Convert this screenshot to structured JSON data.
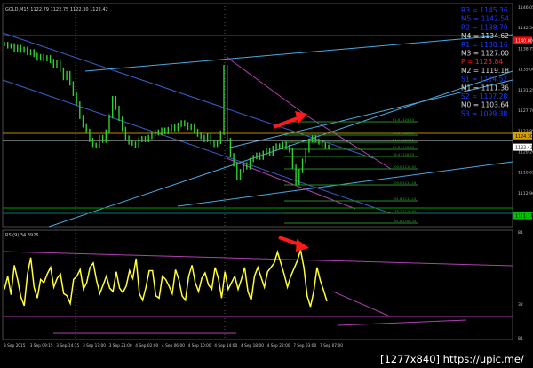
{
  "main_panel": {
    "title": "GOLD,M15  1122.79 1122.75 1122.30 1122.42",
    "y_ticks": [
      "1146.05",
      "1142.30",
      "1138.75",
      "1135.00",
      "1131.25",
      "1127.70",
      "1123.95",
      "1120.20",
      "1116.65",
      "1112.90",
      "1109.35"
    ],
    "price_labels": [
      {
        "text": "1140.00",
        "bg": "#ff0000",
        "fg": "#ffffff",
        "y_value": 1140.0
      },
      {
        "text": "1124.30",
        "bg": "#d4a000",
        "fg": "#000000",
        "y_value": 1124.3
      },
      {
        "text": "1122.42",
        "bg": "#ffffff",
        "fg": "#000000",
        "y_value": 1122.42
      },
      {
        "text": "1111.17",
        "bg": "#00c000",
        "fg": "#000000",
        "y_value": 1111.17
      }
    ],
    "pivots": [
      {
        "label": "R3",
        "value": "1145.36",
        "color": "#1a3cff",
        "bg": "#000000"
      },
      {
        "label": "M5",
        "value": "1142.54",
        "color": "#1a3cff",
        "bg": "#000000"
      },
      {
        "label": "R2",
        "value": "1138.70",
        "color": "#1a3cff",
        "bg": "#000000"
      },
      {
        "label": "M4",
        "value": "1134.62",
        "color": "#d8d8d8",
        "bg": "#000000"
      },
      {
        "label": "R1",
        "value": "1130.16",
        "color": "#1a3cff",
        "bg": "#000000"
      },
      {
        "label": "M3",
        "value": "1127.00",
        "color": "#d8d8d8",
        "bg": "#000000"
      },
      {
        "label": "P",
        "value": "1123.84",
        "color": "#ff2020",
        "bg": "#000000"
      },
      {
        "label": "M2",
        "value": "1119.18",
        "color": "#d8d8d8",
        "bg": "#000000"
      },
      {
        "label": "S1",
        "value": "1114.52",
        "color": "#1a3cff",
        "bg": "#000000"
      },
      {
        "label": "M1",
        "value": "1111.36",
        "color": "#d8d8d8",
        "bg": "#000000"
      },
      {
        "label": "S2",
        "value": "1107.28",
        "color": "#1a3cff",
        "bg": "#000000"
      },
      {
        "label": "M0",
        "value": "1103.64",
        "color": "#d8d8d8",
        "bg": "#000000"
      },
      {
        "label": "S3",
        "value": "1099.38",
        "color": "#1a3cff",
        "bg": "#000000"
      }
    ],
    "fib_labels": [
      "61.8 1124.43",
      "38.2 1122.11",
      "50.0 1120.95",
      "61.8 1119.80",
      "76.4 1118.33",
      "100.0 1116.02",
      "100.0 1114.16",
      "161.8 1112.10",
      "138.2 1110.65",
      "161.8 1108.33"
    ]
  },
  "rsi_panel": {
    "title": "RSI(9) 34.3926",
    "y_ticks": [
      "81",
      "32",
      "81"
    ]
  },
  "x_axis_labels": [
    "3 Sep 2015",
    "3 Sep 09:15",
    "3 Sep 14:15",
    "3 Sep 17:00",
    "3 Sep 21:00",
    "4 Sep 02:00",
    "4 Sep 06:00",
    "4 Sep 10:00",
    "4 Sep 14:00",
    "4 Sep 18:00",
    "4 Sep 22:00",
    "7 Sep 03:00",
    "7 Sep 07:00"
  ],
  "watermark": "[1277x840] https://upic.me/",
  "chart_data": [
    {
      "type": "bar",
      "title": "GOLD,M15",
      "ylim": [
        1109.35,
        1146.05
      ],
      "series": [
        {
          "values": [
            1139.4,
            1139.0,
            1139.2,
            1138.5,
            1138.9,
            1138.3,
            1138.6,
            1137.9,
            1138.2,
            1137.6,
            1137.0,
            1137.4,
            1136.9,
            1137.2,
            1136.6,
            1135.8,
            1136.4,
            1135.2,
            1133.8,
            1134.6,
            1132.9,
            1131.2,
            1129.6,
            1127.4,
            1126.0,
            1125.1,
            1123.6,
            1122.8,
            1122.6,
            1124.1,
            1123.5,
            1125.0,
            1127.5,
            1130.5,
            1128.9,
            1127.1,
            1125.4,
            1124.0,
            1123.2,
            1123.0,
            1122.7,
            1123.6,
            1123.9,
            1123.6,
            1124.1,
            1124.6,
            1125.0,
            1124.7,
            1125.3,
            1124.9,
            1125.4,
            1125.8,
            1125.4,
            1126.1,
            1126.5,
            1126.2,
            1125.6,
            1126.0,
            1125.1,
            1124.5,
            1124.1,
            1123.6,
            1124.4,
            1123.2,
            1122.8,
            1123.3,
            1124.8,
            1135.6,
            1123.6,
            1121.1,
            1119.6,
            1117.4,
            1118.5,
            1119.6,
            1119.1,
            1120.3,
            1120.8,
            1121.2,
            1120.7,
            1121.5,
            1122.0,
            1121.4,
            1122.3,
            1122.7,
            1122.4,
            1123.0,
            1122.5,
            1121.9,
            1119.2,
            1116.6,
            1118.5,
            1120.2,
            1121.9,
            1123.5,
            1124.0,
            1123.5,
            1123.2,
            1122.8,
            1122.5,
            1122.4
          ]
        }
      ]
    },
    {
      "type": "line",
      "title": "RSI(9) 34.3926",
      "ylim": [
        0,
        100
      ],
      "series": [
        {
          "values": [
            46,
            58,
            41,
            68,
            55,
            39,
            31,
            60,
            75,
            48,
            38,
            55,
            52,
            60,
            66,
            48,
            56,
            60,
            42,
            40,
            33,
            55,
            58,
            64,
            46,
            52,
            66,
            70,
            54,
            42,
            50,
            58,
            47,
            44,
            62,
            47,
            43,
            49,
            63,
            56,
            74,
            42,
            36,
            48,
            63,
            63,
            40,
            38,
            58,
            55,
            49,
            42,
            64,
            55,
            40,
            36,
            58,
            68,
            52,
            44,
            56,
            61,
            50,
            46,
            66,
            56,
            38,
            62,
            46,
            52,
            58,
            46,
            55,
            66,
            44,
            36,
            58,
            66,
            57,
            48,
            62,
            66,
            70,
            80,
            70,
            60,
            48,
            58,
            65,
            72,
            82,
            66,
            40,
            30,
            44,
            66,
            54,
            45,
            35
          ]
        }
      ]
    }
  ]
}
